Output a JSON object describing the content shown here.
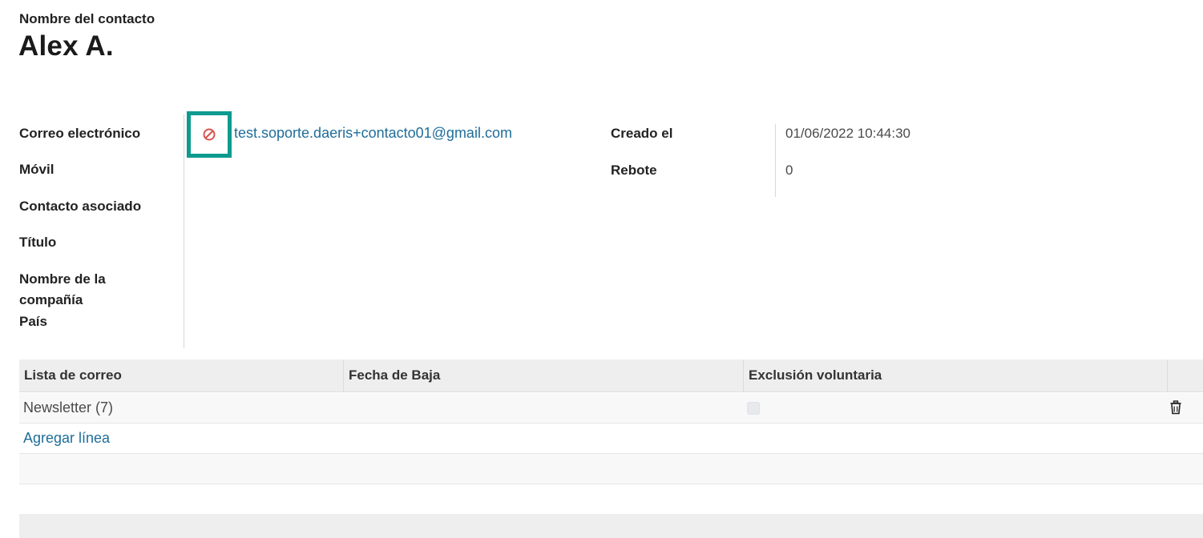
{
  "contact": {
    "name_label": "Nombre del contacto",
    "name_value": "Alex A."
  },
  "fields": {
    "email_label": "Correo electrónico",
    "email_value": "test.soporte.daeris+contacto01@gmail.com",
    "mobile_label": "Móvil",
    "associated_contact_label": "Contacto asociado",
    "title_label": "Título",
    "company_name_label_line1": "Nombre de la",
    "company_name_label_line2": "compañía",
    "country_label": "País",
    "created_label": "Creado el",
    "created_value": "01/06/2022 10:44:30",
    "bounce_label": "Rebote",
    "bounce_value": "0"
  },
  "icons": {
    "blacklist": "ban-icon",
    "delete": "trash-icon"
  },
  "colors": {
    "accent_border": "#0d9b8f",
    "link": "#1f6d99",
    "ban_red": "#d9534f"
  },
  "table": {
    "headers": [
      "Lista de correo",
      "Fecha de Baja",
      "Exclusión voluntaria"
    ],
    "rows": [
      {
        "mailing_list": "Newsletter (7)",
        "unsubscription_date": "",
        "opt_out": false
      }
    ],
    "add_line_label": "Agregar línea"
  }
}
